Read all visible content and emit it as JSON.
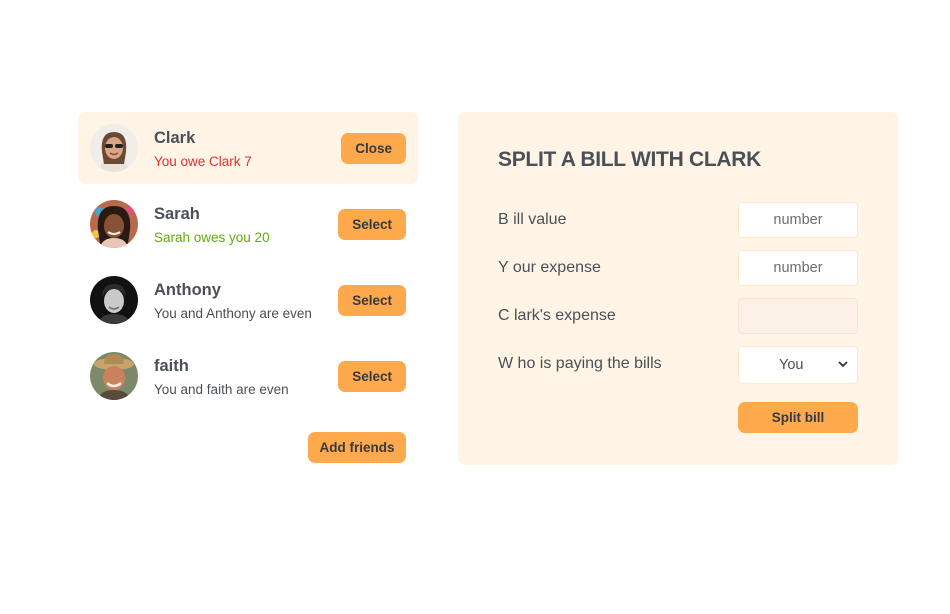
{
  "friends": [
    {
      "name": "Clark",
      "status": "You owe Clark 7",
      "status_color": "#e03131",
      "button": "Close",
      "selected": true
    },
    {
      "name": "Sarah",
      "status": "Sarah owes you 20",
      "status_color": "#66a80f",
      "button": "Select",
      "selected": false
    },
    {
      "name": "Anthony",
      "status": "You and Anthony are even",
      "status_color": "#495057",
      "button": "Select",
      "selected": false
    },
    {
      "name": "faith",
      "status": "You and faith are even",
      "status_color": "#495057",
      "button": "Select",
      "selected": false
    }
  ],
  "add_friends_label": "Add friends",
  "form": {
    "title": "SPLIT A BILL WITH CLARK",
    "bill_label": "B ill value",
    "bill_placeholder": "number",
    "expense_label": "Y our expense",
    "expense_placeholder": "number",
    "friend_expense_label": "C lark's expense",
    "payer_label": "W ho is paying the bills",
    "payer_value": "You",
    "submit_label": "Split bill"
  },
  "colors": {
    "accent": "#ffa94d",
    "panel_bg": "#fff4e6",
    "owe_red": "#e03131",
    "owed_green": "#66a80f"
  }
}
